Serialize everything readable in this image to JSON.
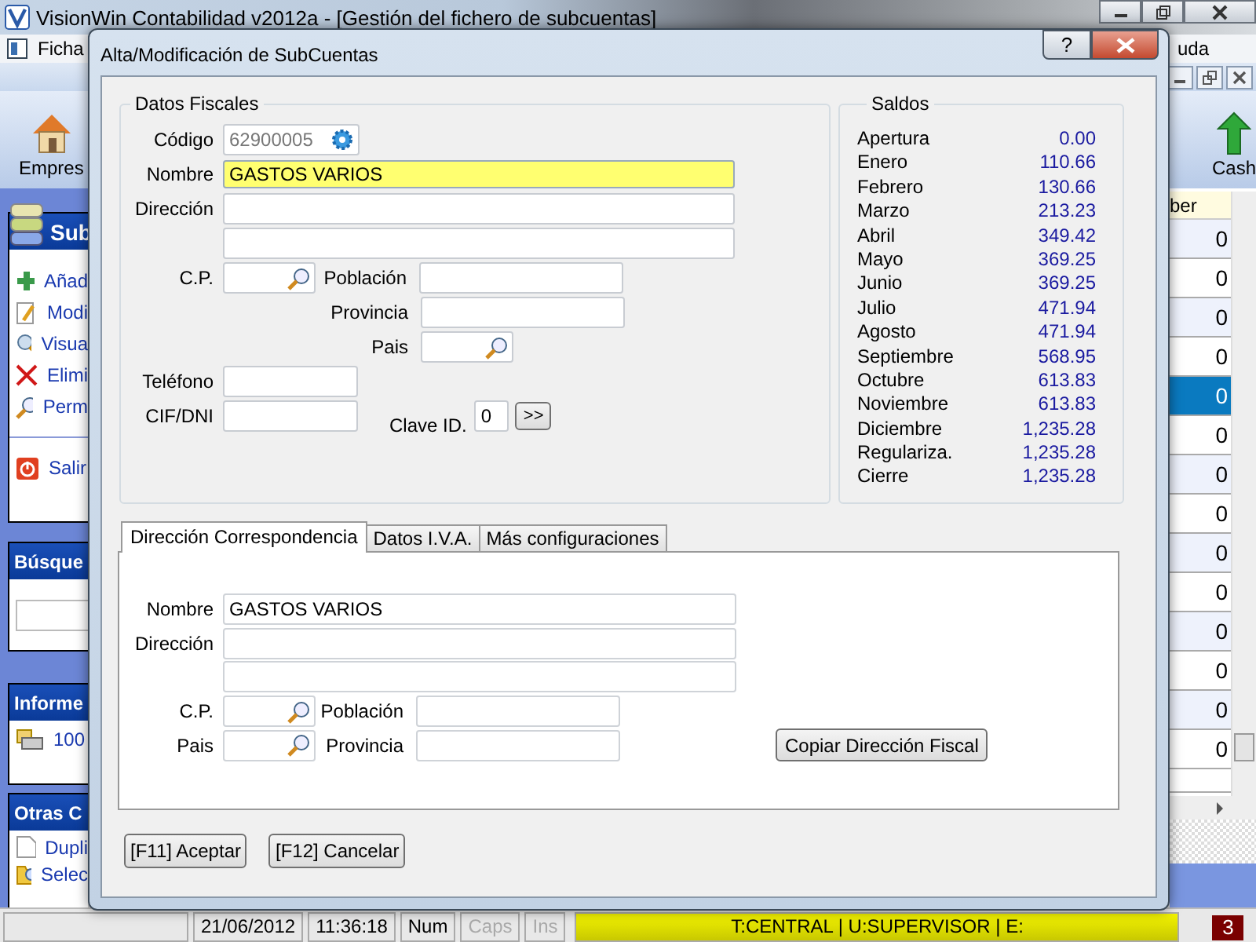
{
  "app": {
    "title": "VisionWin Contabilidad v2012a - [Gestión del fichero de subcuentas]",
    "menu": [
      "Ficha",
      "uda"
    ],
    "toolbar": [
      {
        "label": "Empres",
        "kind": "house"
      },
      {
        "label": "Cash",
        "kind": "cash"
      }
    ],
    "sidebar": [
      {
        "title": "Sub",
        "kind": "list",
        "items": [
          {
            "label": "Añad",
            "kind": "plus",
            "divider": false
          },
          {
            "label": "Modi",
            "kind": "edit",
            "divider": false
          },
          {
            "label": "Visua",
            "kind": "view",
            "divider": false
          },
          {
            "label": "Elimi",
            "kind": "delete",
            "divider": false
          },
          {
            "label": "Perm",
            "kind": "search",
            "divider": false
          },
          {
            "label": "Salir",
            "kind": "exit",
            "divider": true
          }
        ]
      },
      {
        "title": "Búsque",
        "kind": "search"
      },
      {
        "title": "Informe",
        "kind": "list",
        "items": [
          {
            "label": "100",
            "kind": "printer",
            "divider": false
          }
        ]
      },
      {
        "title": "Otras C",
        "kind": "list",
        "items": [
          {
            "label": "Dupli",
            "kind": "page",
            "divider": false
          },
          {
            "label": "Selec",
            "kind": "folder",
            "divider": false
          }
        ]
      }
    ],
    "grid": {
      "header": "ber",
      "rows": [
        {
          "value": "0",
          "selected": false
        },
        {
          "value": "0",
          "selected": false
        },
        {
          "value": "0",
          "selected": false
        },
        {
          "value": "0",
          "selected": false
        },
        {
          "value": "0",
          "selected": true
        },
        {
          "value": "0",
          "selected": false
        },
        {
          "value": "0",
          "selected": false
        },
        {
          "value": "0",
          "selected": false
        },
        {
          "value": "0",
          "selected": false
        },
        {
          "value": "0",
          "selected": false
        },
        {
          "value": "0",
          "selected": false
        },
        {
          "value": "0",
          "selected": false
        },
        {
          "value": "0",
          "selected": false
        },
        {
          "value": "0",
          "selected": false
        }
      ]
    },
    "status_bar": {
      "date": "21/06/2012",
      "time": "11:36:18",
      "keys": [
        {
          "label": "Num",
          "disabled": false
        },
        {
          "label": "Caps",
          "disabled": true
        },
        {
          "label": "Ins",
          "disabled": true
        }
      ],
      "session": "T:CENTRAL | U:SUPERVISOR | E:",
      "alert": "3"
    }
  },
  "dialog": {
    "title": "Alta/Modificación de SubCuentas",
    "help_button": "?",
    "fiscal": {
      "title": "Datos Fiscales",
      "code_label": "Código",
      "code": "62900005",
      "code_readonly": true,
      "name_label": "Nombre",
      "name": "GASTOS VARIOS",
      "name_focused": true,
      "address_label": "Dirección",
      "postal_label": "C.P.",
      "town_label": "Población",
      "province_label": "Provincia",
      "country_label": "Pais",
      "phone_label": "Teléfono",
      "tax_id_label": "CIF/DNI",
      "key_label": "Clave ID.",
      "key": "0",
      "key_button": ">>"
    },
    "balances": {
      "title": "Saldos",
      "rows": [
        {
          "label": "Apertura",
          "value": "0.00"
        },
        {
          "label": "Enero",
          "value": "110.66"
        },
        {
          "label": "Febrero",
          "value": "130.66"
        },
        {
          "label": "Marzo",
          "value": "213.23"
        },
        {
          "label": "Abril",
          "value": "349.42"
        },
        {
          "label": "Mayo",
          "value": "369.25"
        },
        {
          "label": "Junio",
          "value": "369.25"
        },
        {
          "label": "Julio",
          "value": "471.94"
        },
        {
          "label": "Agosto",
          "value": "471.94"
        },
        {
          "label": "Septiembre",
          "value": "568.95"
        },
        {
          "label": "Octubre",
          "value": "613.83"
        },
        {
          "label": "Noviembre",
          "value": "613.83"
        },
        {
          "label": "Diciembre",
          "value": "1,235.28"
        },
        {
          "label": "Regulariza.",
          "value": "1,235.28"
        },
        {
          "label": "Cierre",
          "value": "1,235.28"
        }
      ]
    },
    "tabs": [
      {
        "label": "Dirección Correspondencia",
        "selected": true
      },
      {
        "label": "Datos I.V.A.",
        "selected": false
      },
      {
        "label": "Más configuraciones",
        "selected": false
      }
    ],
    "mailing": {
      "name_label": "Nombre",
      "name": "GASTOS VARIOS",
      "address_label": "Dirección",
      "postal_label": "C.P.",
      "town_label": "Población",
      "country_label": "Pais",
      "province_label": "Provincia",
      "copy_button": "Copiar Dirección Fiscal"
    },
    "buttons": [
      "[F11] Aceptar",
      "[F12] Cancelar"
    ]
  }
}
